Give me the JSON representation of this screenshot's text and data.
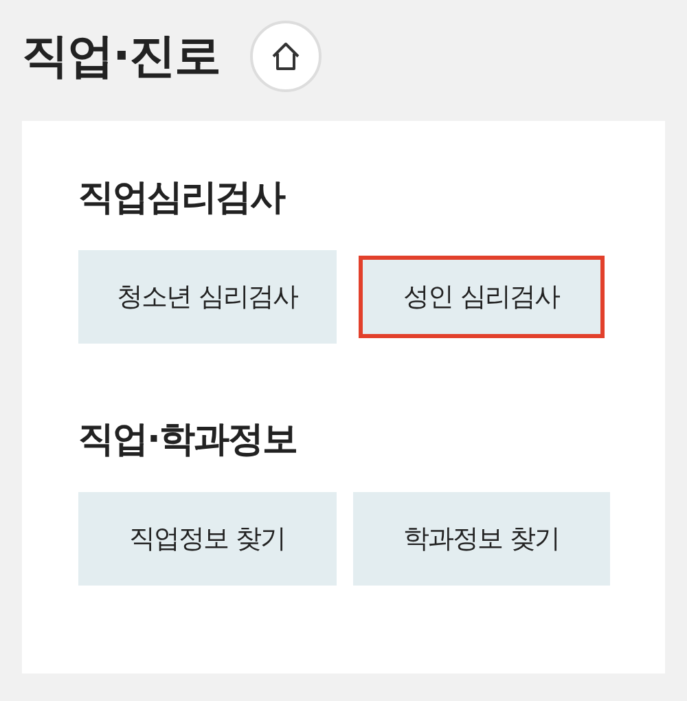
{
  "header": {
    "title": "직업·진로"
  },
  "sections": [
    {
      "title": "직업심리검사",
      "buttons": [
        {
          "label": "청소년 심리검사",
          "selected": false
        },
        {
          "label": "성인 심리검사",
          "selected": true
        }
      ]
    },
    {
      "title": "직업·학과정보",
      "buttons": [
        {
          "label": "직업정보 찾기",
          "selected": false
        },
        {
          "label": "학과정보 찾기",
          "selected": false
        }
      ]
    }
  ]
}
